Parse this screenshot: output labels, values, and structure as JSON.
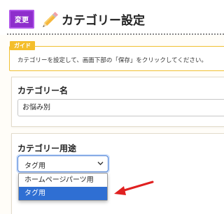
{
  "header": {
    "change_button_label": "変更",
    "title": "カテゴリー設定"
  },
  "guide": {
    "tag": "ガイド",
    "text": "カテゴリーを設定して、画面下部の「保存」をクリックしてください。"
  },
  "category_name": {
    "label": "カテゴリー名",
    "value": "お悩み別"
  },
  "category_usage": {
    "label": "カテゴリー用途",
    "selected": "タグ用",
    "options": [
      "ホームページパーツ用",
      "タグ用"
    ]
  },
  "colors": {
    "accent_purple": "#8e2ecc",
    "guide_yellow": "#f4be2b",
    "selection_blue": "#2f6fd3",
    "arrow_red": "#e02020"
  },
  "icons": [
    "pencil-icon",
    "chevron-down-icon",
    "red-arrow-annotation"
  ]
}
